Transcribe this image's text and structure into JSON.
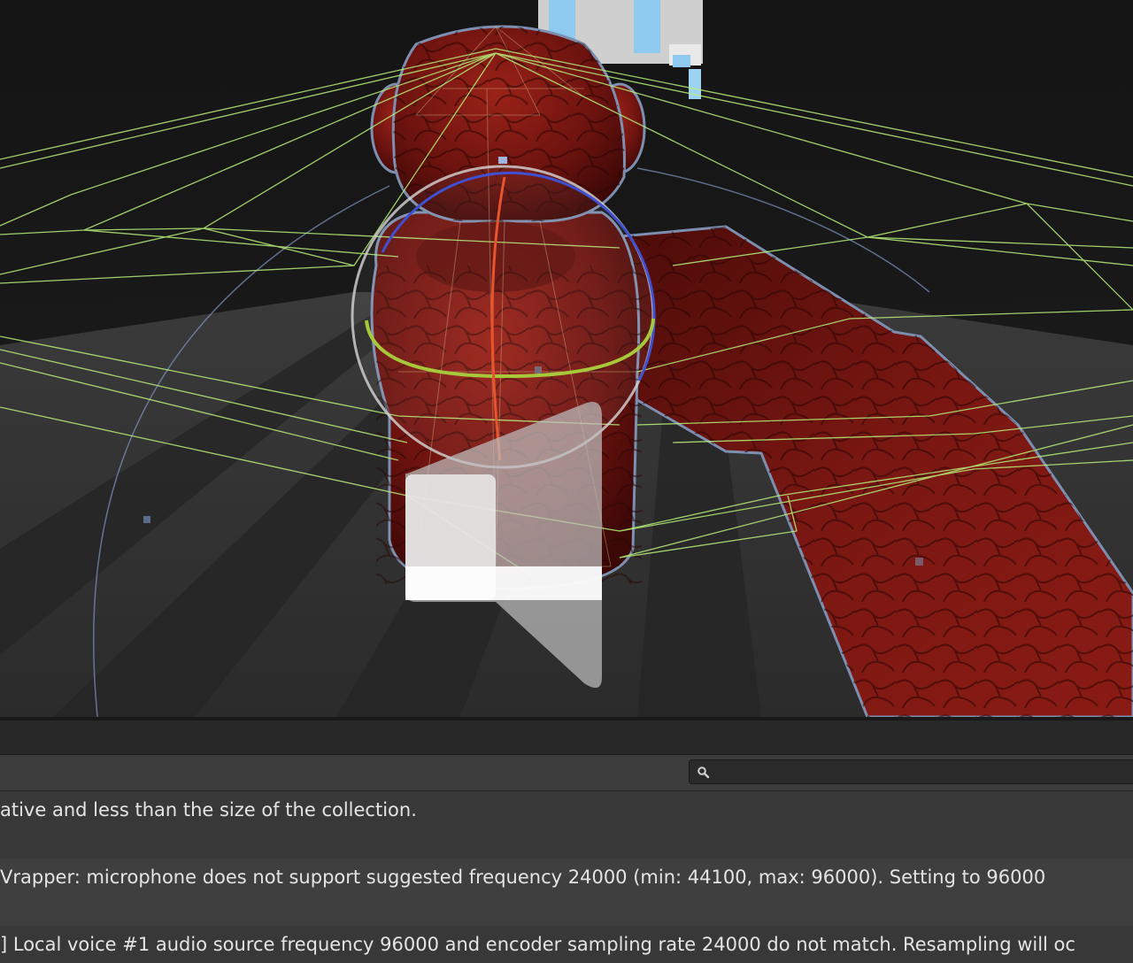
{
  "scene_view": {
    "gizmos": [
      "rotate-gizmo",
      "audio-source-icon",
      "collider-wireframe"
    ]
  },
  "console": {
    "search": {
      "value": "",
      "placeholder": ""
    },
    "search_icon": "magnifier-icon",
    "entries": [
      {
        "message": "ative and less than the size of the collection."
      },
      {
        "message": "Vrapper: microphone does not support suggested frequency 24000 (min: 44100, max: 96000). Setting to 96000"
      },
      {
        "message": "] Local voice #1 audio source frequency 96000 and encoder sampling rate 24000 do not match. Resampling will oc"
      }
    ]
  },
  "colors": {
    "scene_bg": "#1c1c1c",
    "mesh_red": "#7a1410",
    "selection_outline": "#7d8fb0",
    "wireframe_green": "#b8f07a",
    "gizmo_x_red": "#e8542c",
    "gizmo_y_green": "#a8c83c",
    "gizmo_z_blue": "#4050d0",
    "console_bg": "#383838",
    "console_row_alt": "#3f3f3f"
  }
}
